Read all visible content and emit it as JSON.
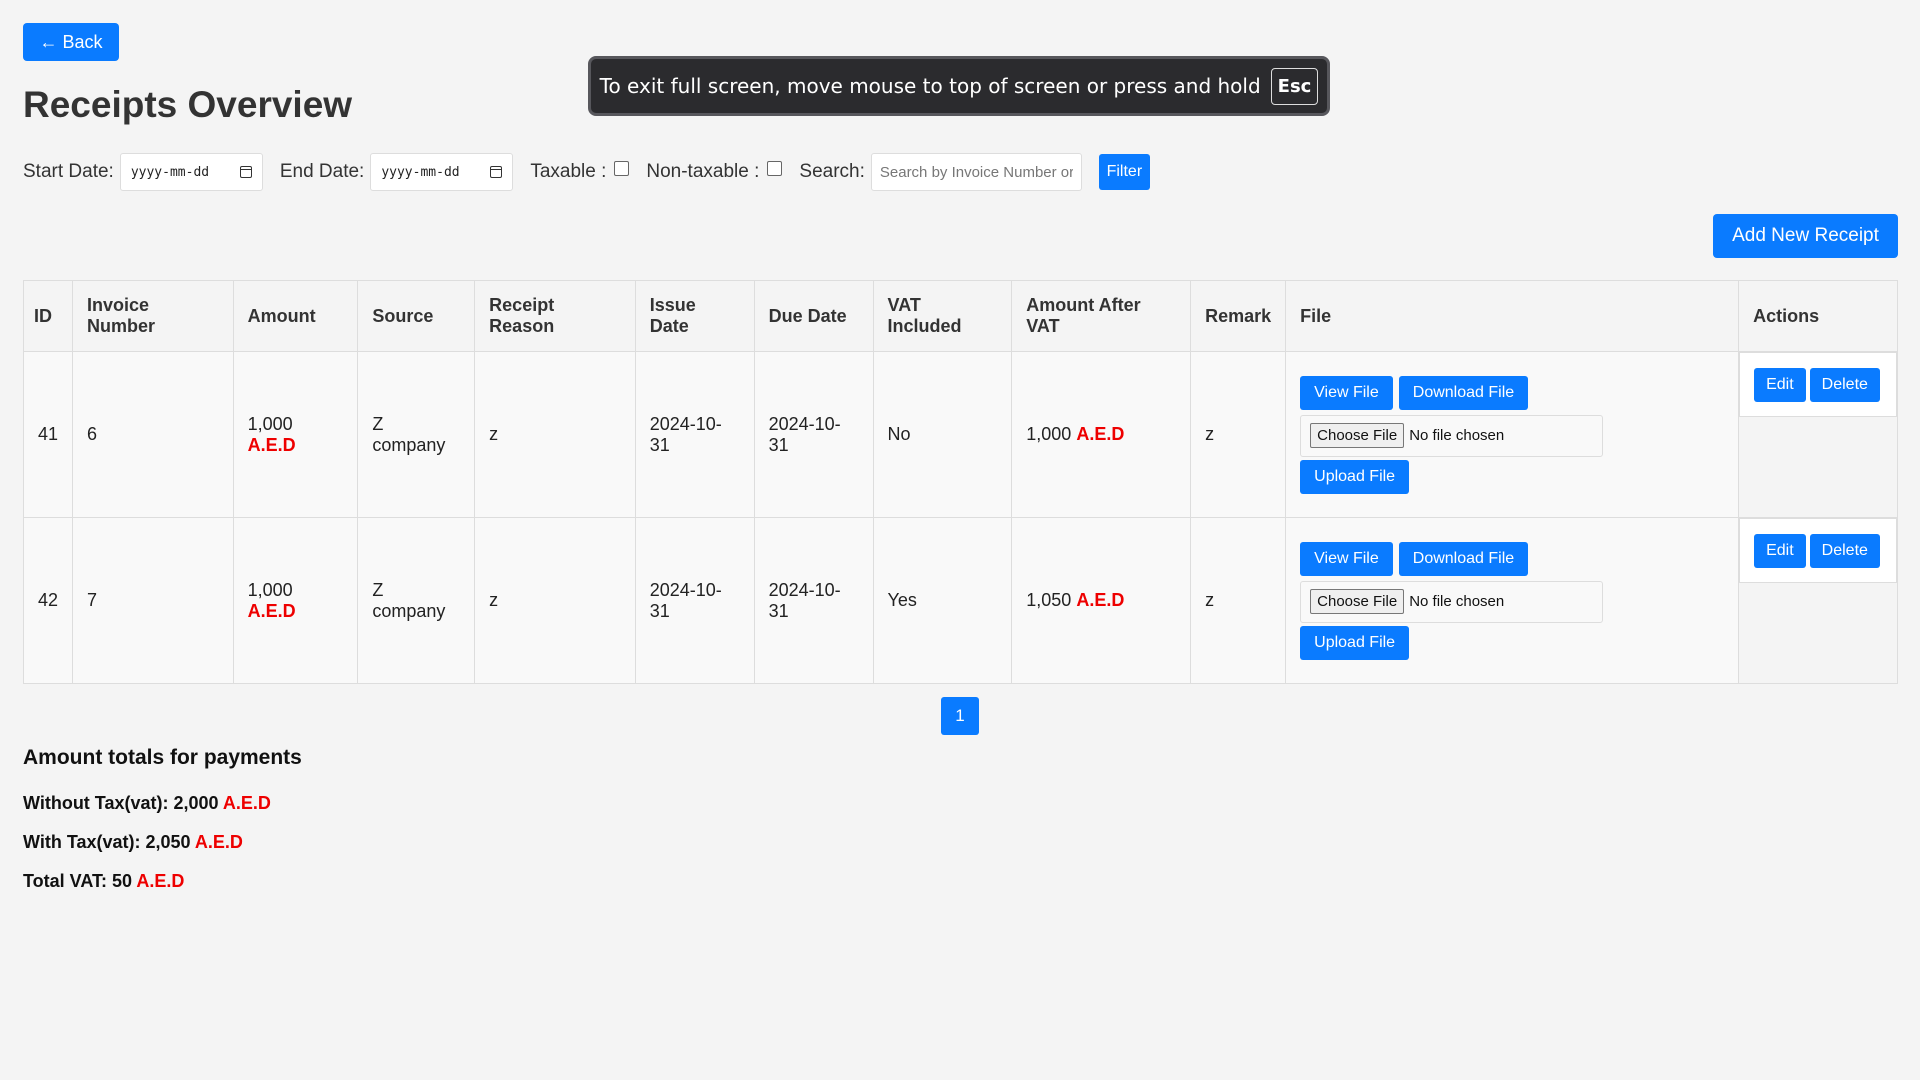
{
  "header": {
    "back_label": "← Back",
    "title": "Receipts Overview"
  },
  "fullscreen_banner": {
    "text": "To exit full screen, move mouse to top of screen or press and hold",
    "key": "Esc"
  },
  "filters": {
    "start_label": "Start Date:",
    "start_value": "yyyy-mm-dd",
    "end_label": "End Date:",
    "end_value": "yyyy-mm-dd",
    "taxable_label": "Taxable :",
    "nontaxable_label": "Non-taxable :",
    "search_label": "Search:",
    "search_placeholder": "Search by Invoice Number or",
    "filter_label": "Filter"
  },
  "add_label": "Add New Receipt",
  "table": {
    "headers": [
      "ID",
      "Invoice Number",
      "Amount",
      "Source",
      "Receipt Reason",
      "Issue Date",
      "Due Date",
      "VAT Included",
      "Amount After VAT",
      "Remark",
      "File",
      "Actions"
    ],
    "rows": [
      {
        "id": "41",
        "invoice": "6",
        "amount": "1,000",
        "currency": "A.E.D",
        "source": "Z company",
        "reason": "z",
        "issue": "2024-10-31",
        "due": "2024-10-31",
        "vat": "No",
        "after_vat": "1,000",
        "remark": "z"
      },
      {
        "id": "42",
        "invoice": "7",
        "amount": "1,000",
        "currency": "A.E.D",
        "source": "Z company",
        "reason": "z",
        "issue": "2024-10-31",
        "due": "2024-10-31",
        "vat": "Yes",
        "after_vat": "1,050",
        "remark": "z"
      }
    ],
    "file_actions": {
      "view": "View File",
      "download": "Download File",
      "choose": "Choose File",
      "no_file": "No file chosen",
      "upload": "Upload File"
    },
    "row_actions": {
      "edit": "Edit",
      "delete": "Delete"
    }
  },
  "pagination": {
    "current": "1"
  },
  "totals": {
    "heading": "Amount totals for payments",
    "without_tax_label": "Without Tax(vat): 2,000",
    "with_tax_label": "With Tax(vat): 2,050",
    "total_vat_label": "Total VAT: 50",
    "currency": "A.E.D"
  },
  "colors": {
    "primary": "#0a7bff",
    "currency": "#e00000",
    "background": "#f4f4f4"
  }
}
